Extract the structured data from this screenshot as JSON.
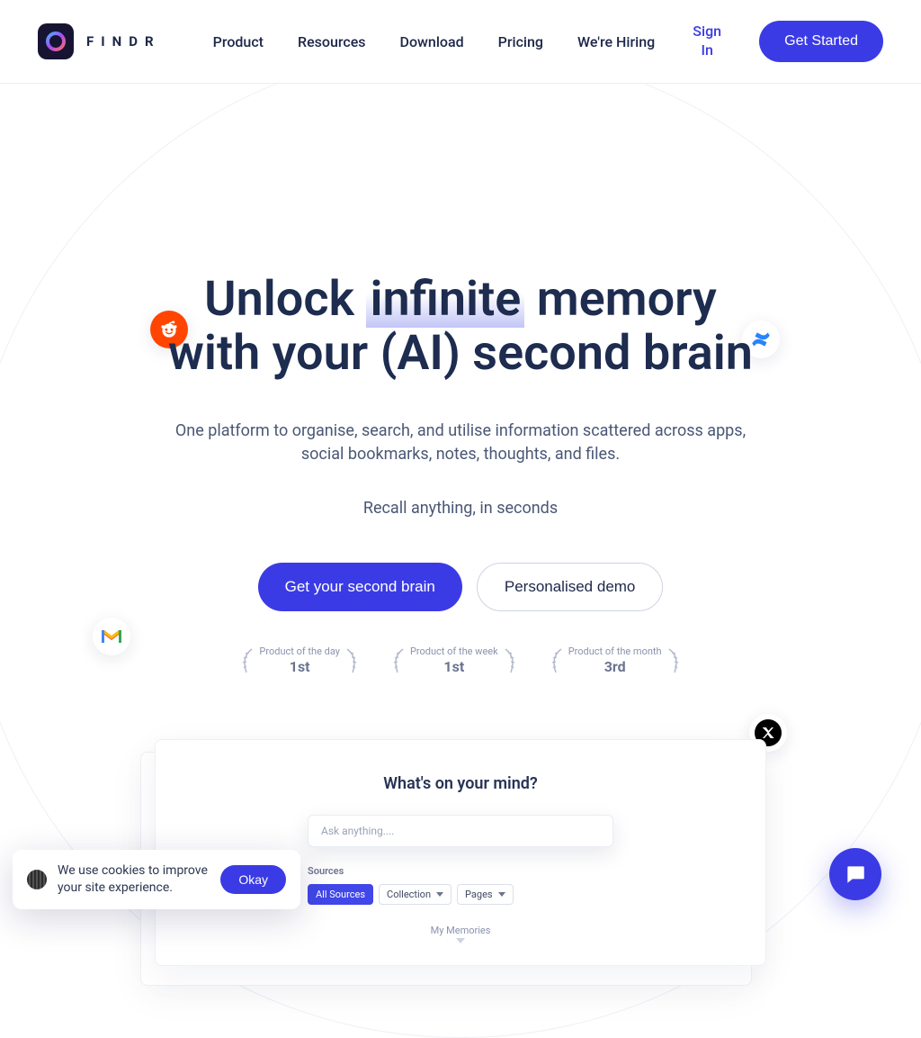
{
  "brand": {
    "name": "FINDR"
  },
  "nav": {
    "items": [
      "Product",
      "Resources",
      "Download",
      "Pricing",
      "We're Hiring"
    ],
    "signin": "Sign In",
    "cta": "Get Started"
  },
  "hero": {
    "title_pre": "Unlock ",
    "title_hl": "infinite",
    "title_post": " memory",
    "title_line2": "with your (AI) second brain",
    "sub": "One platform to organise, search, and utilise information scattered across apps, social bookmarks, notes, thoughts, and files.",
    "sub2": "Recall anything, in seconds",
    "cta_primary": "Get your second brain",
    "cta_secondary": "Personalised demo"
  },
  "awards": [
    {
      "label": "Product of the day",
      "rank": "1st"
    },
    {
      "label": "Product of the week",
      "rank": "1st"
    },
    {
      "label": "Product of the month",
      "rank": "3rd"
    }
  ],
  "preview": {
    "title": "What's on your mind?",
    "ask_placeholder": "Ask anything....",
    "sources_label": "Sources",
    "chips": {
      "all": "All Sources",
      "collection": "Collection",
      "pages": "Pages"
    },
    "memories": "My Memories"
  },
  "float_icons": {
    "reddit": "reddit-icon",
    "confluence": "confluence-icon",
    "gmail": "gmail-icon",
    "x": "x-icon"
  },
  "cookie": {
    "text": "We use cookies to improve your site experience.",
    "ok": "Okay"
  }
}
